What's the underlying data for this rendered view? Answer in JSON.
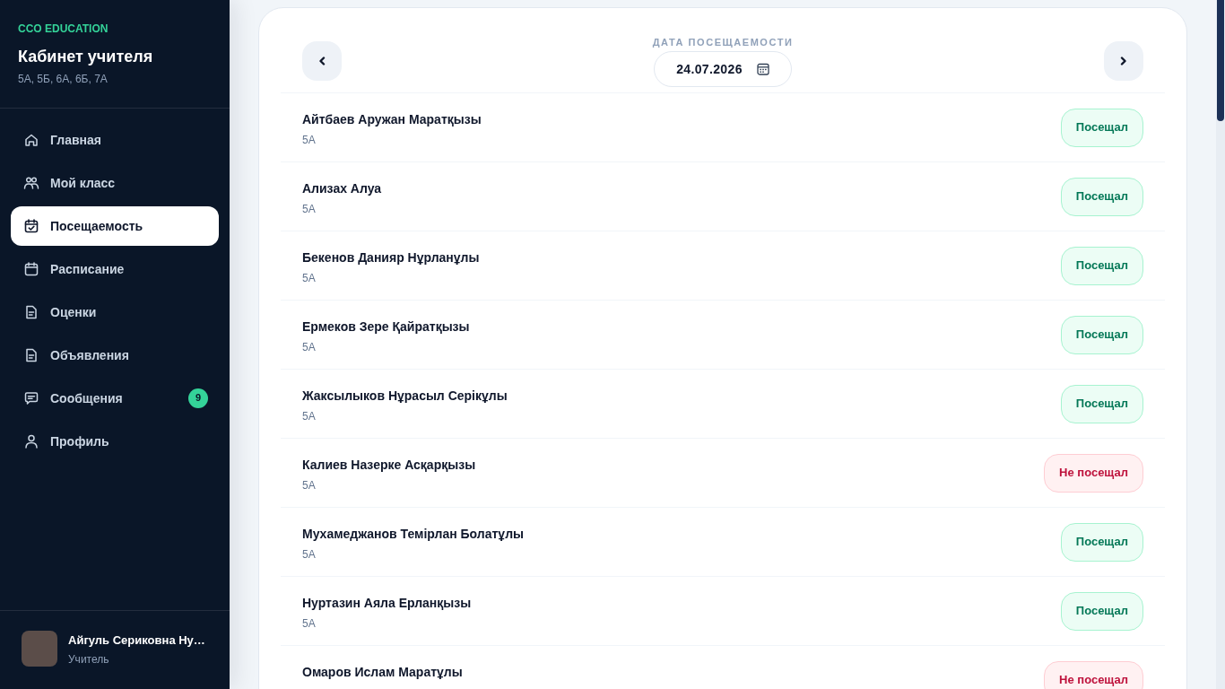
{
  "sidebar": {
    "brand": "CCO EDUCATION",
    "title": "Кабинет учителя",
    "classes": "5А, 5Б, 6А, 6Б, 7А",
    "nav": [
      {
        "label": "Главная",
        "selected": false
      },
      {
        "label": "Мой класс",
        "selected": false
      },
      {
        "label": "Посещаемость",
        "selected": true
      },
      {
        "label": "Расписание",
        "selected": false
      },
      {
        "label": "Оценки",
        "selected": false
      },
      {
        "label": "Объявления",
        "selected": false
      },
      {
        "label": "Сообщения",
        "selected": false,
        "badge": "9"
      },
      {
        "label": "Профиль",
        "selected": false
      }
    ],
    "user": {
      "name": "Айгуль Сериковна Ну…",
      "role": "Учитель"
    }
  },
  "attendance": {
    "date_label": "ДАТА ПОСЕЩАЕМОСТИ",
    "date_field": {
      "value": "24.07.2026"
    },
    "students": [
      {
        "name": "Айтбаев Аружан Маратқызы",
        "class": "5А",
        "attended": true,
        "status": "Посещал"
      },
      {
        "name": "Ализах Алуа",
        "class": "5А",
        "attended": true,
        "status": "Посещал"
      },
      {
        "name": "Бекенов Данияр Нұрланұлы",
        "class": "5А",
        "attended": true,
        "status": "Посещал"
      },
      {
        "name": "Ермеков Зере Қайратқызы",
        "class": "5А",
        "attended": true,
        "status": "Посещал"
      },
      {
        "name": "Жаксылыков Нұрасыл Серікұлы",
        "class": "5А",
        "attended": true,
        "status": "Посещал"
      },
      {
        "name": "Калиев Назерке Асқарқызы",
        "class": "5А",
        "attended": false,
        "status": "Не посещал"
      },
      {
        "name": "Мухамеджанов Темірлан Болатұлы",
        "class": "5А",
        "attended": true,
        "status": "Посещал"
      },
      {
        "name": "Нуртазин Аяла Ерланқызы",
        "class": "5А",
        "attended": true,
        "status": "Посещал"
      },
      {
        "name": "Омаров Ислам Маратұлы",
        "attended": false,
        "status": "Не посещал"
      }
    ]
  }
}
